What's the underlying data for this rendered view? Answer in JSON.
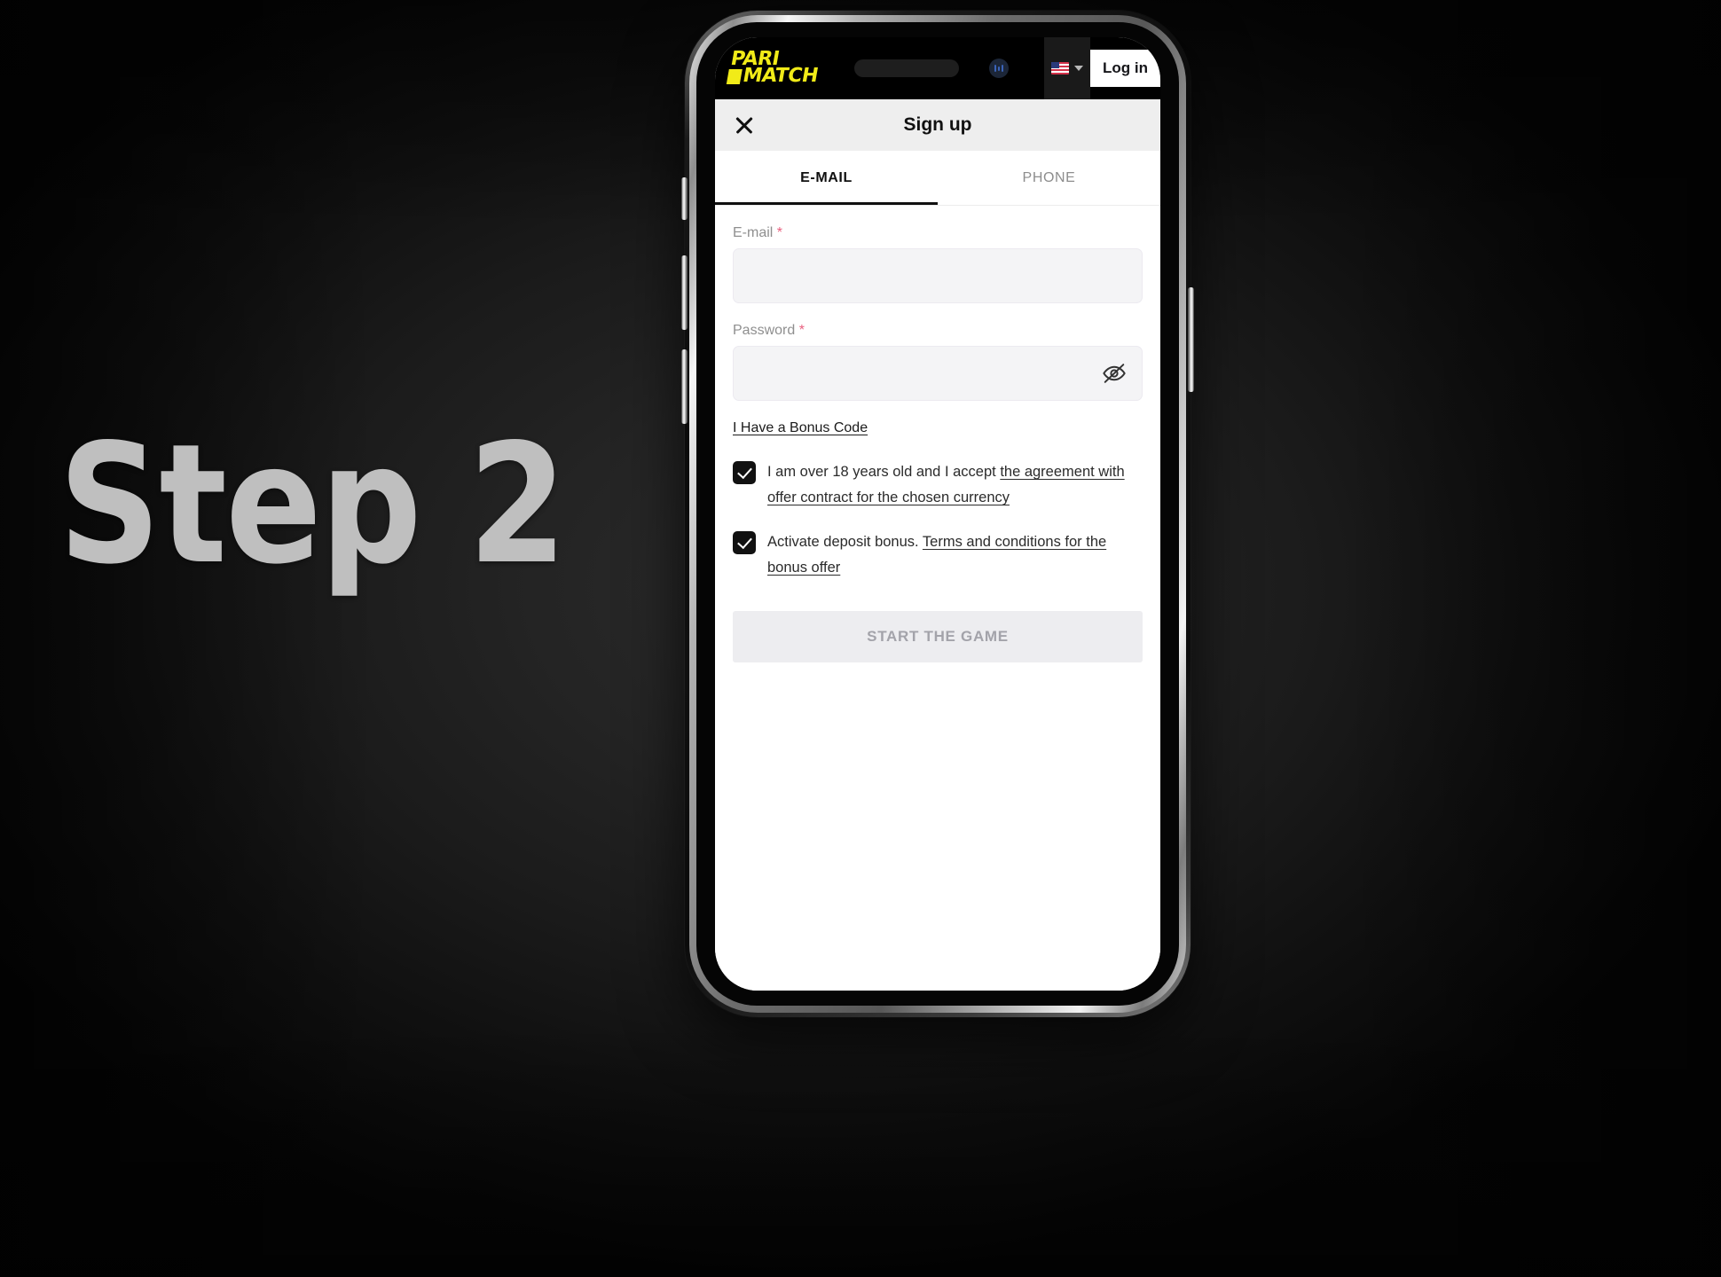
{
  "slide": {
    "step_caption": "Step 2"
  },
  "phone": {
    "buttons": {
      "mute": "mute-switch",
      "volume_up": "volume-up-button",
      "volume_down": "volume-down-button",
      "power": "power-button"
    }
  },
  "app_header": {
    "logo_line1": "PARI",
    "logo_line2": "MATCH",
    "search_placeholder": "",
    "language_flag": "us-flag-icon",
    "login_label": "Log in"
  },
  "modal": {
    "title": "Sign up",
    "close_icon": "close-icon"
  },
  "tabs": [
    {
      "label": "E-MAIL",
      "active": true
    },
    {
      "label": "PHONE",
      "active": false
    }
  ],
  "form": {
    "email": {
      "label": "E-mail",
      "required_mark": "*",
      "value": "",
      "placeholder": ""
    },
    "password": {
      "label": "Password",
      "required_mark": "*",
      "value": "",
      "placeholder": "",
      "toggle_icon": "eye-off-icon"
    },
    "bonus_code_link": "I Have a Bonus Code",
    "checkboxes": [
      {
        "checked": true,
        "text_plain": "I am over 18 years old and I accept ",
        "text_link": "the agreement with offer contract for the chosen currency"
      },
      {
        "checked": true,
        "text_plain": "Activate deposit bonus. ",
        "text_link": "Terms and conditions for the bonus offer"
      }
    ],
    "submit_label": "START THE GAME"
  },
  "colors": {
    "brand_yellow": "#f1eb18",
    "header_black": "#000000",
    "modal_bar": "#eeeeee",
    "input_bg": "#f4f4f6",
    "required_red": "#e8607f",
    "submit_disabled_bg": "#ededf0",
    "submit_disabled_text": "#a3a3aa",
    "caption_grey": "#bfbfbf"
  }
}
